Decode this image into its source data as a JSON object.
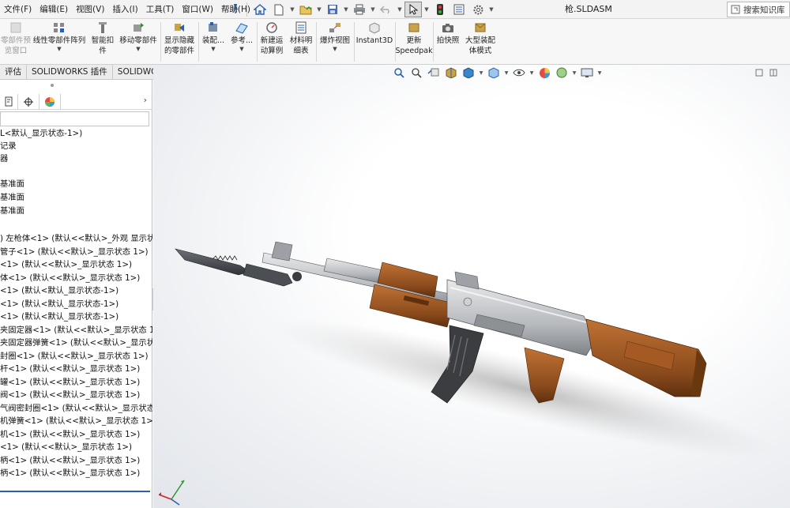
{
  "menubar": {
    "menus": [
      "文件(F)",
      "编辑(E)",
      "视图(V)",
      "插入(I)",
      "工具(T)",
      "窗口(W)",
      "帮助(H)"
    ],
    "document_title": "枪.SLDASM",
    "search_label": "搜索知识库"
  },
  "ribbon": {
    "buttons": [
      {
        "label": "零部件预\n览窗口",
        "disabled": true
      },
      {
        "label": "线性零部件阵列"
      },
      {
        "label": "智能扣\n件"
      },
      {
        "label": "移动零部件"
      },
      {
        "label": "显示隐藏\n的零部件"
      },
      {
        "label": "装配..."
      },
      {
        "label": "参考..."
      },
      {
        "label": "新建运\n动算例"
      },
      {
        "label": "材料明\n细表"
      },
      {
        "label": "爆炸视图"
      },
      {
        "label": "Instant3D"
      },
      {
        "label": "更新\nSpeedpak"
      },
      {
        "label": "拍快照"
      },
      {
        "label": "大型装配\n体模式"
      }
    ]
  },
  "command_tabs": [
    "评估",
    "SOLIDWORKS 插件",
    "SOLIDWORKS MBD"
  ],
  "feature_tree": {
    "nodes": [
      "L<默认_显示状态-1>)",
      "记录",
      "器",
      "",
      "基准面",
      "基准面",
      "基准面",
      "",
      ") 左枪体<1> (默认<<默认>_外观 显示状",
      "管子<1> (默认<<默认>_显示状态 1>)",
      "<1> (默认<<默认>_显示状态 1>)",
      "体<1> (默认<<默认>_显示状态 1>)",
      "<1> (默认<默认_显示状态-1>)",
      "<1> (默认<默认_显示状态-1>)",
      "<1> (默认<默认_显示状态-1>)",
      "夹固定器<1> (默认<<默认>_显示状态 1",
      "夹固定器弹簧<1> (默认<<默认>_显示状",
      "封圈<1> (默认<<默认>_显示状态 1>)",
      "杆<1> (默认<<默认>_显示状态 1>)",
      "罐<1> (默认<<默认>_显示状态 1>)",
      "阀<1> (默认<<默认>_显示状态 1>)",
      "气阀密封圈<1> (默认<<默认>_显示状态",
      "机弹簧<1> (默认<<默认>_显示状态 1>)",
      "机<1> (默认<<默认>_显示状态 1>)",
      "<1> (默认<<默认>_显示状态 1>)",
      "柄<1> (默认<<默认>_显示状态 1>)",
      "柄<1> (默认<<默认>_显示状态 1>)"
    ]
  },
  "colors": {
    "wood": "#8a4a1c",
    "wood_light": "#b86a2e",
    "metal": "#c8cacd",
    "metal_dark": "#5c5f63",
    "magazine": "#3b3d40",
    "accent": "#2d5fb0"
  },
  "icons": {
    "toolbar": [
      "home-icon",
      "new-doc-icon",
      "open-icon",
      "save-icon",
      "print-icon",
      "undo-icon",
      "select-icon",
      "rebuild-icon",
      "file-properties-icon",
      "options-icon"
    ],
    "heads_up": [
      "zoom-to-fit-icon",
      "zoom-area-icon",
      "previous-view-icon",
      "section-view-icon",
      "view-orientation-icon",
      "display-style-icon",
      "hide-show-icon",
      "appearance-icon",
      "scene-icon",
      "view-settings-icon"
    ]
  }
}
